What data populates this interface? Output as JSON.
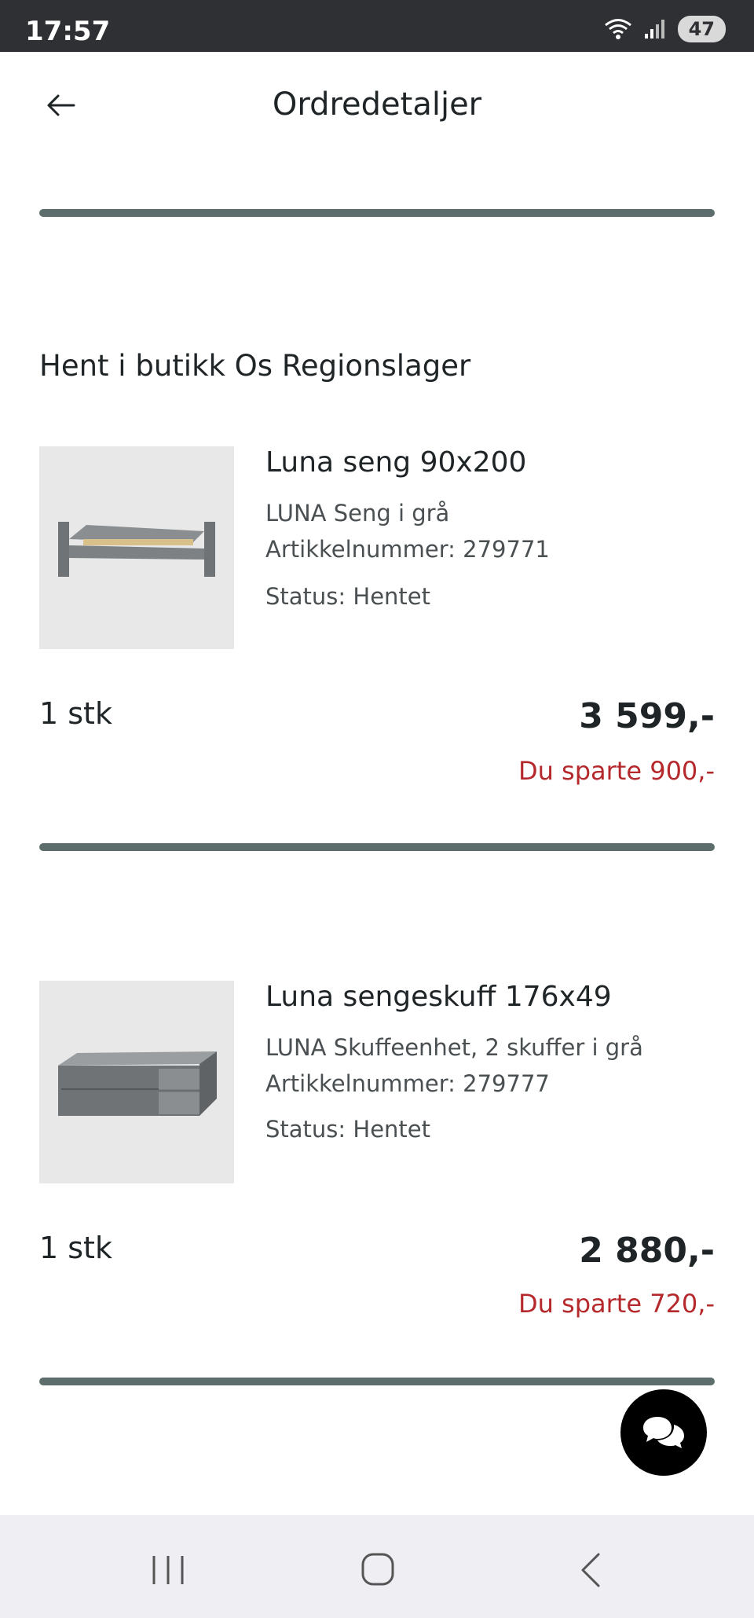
{
  "status_bar": {
    "time": "17:57",
    "battery": "47"
  },
  "header": {
    "title": "Ordredetaljer"
  },
  "section": {
    "title": "Hent i butikk Os Regionslager"
  },
  "items": [
    {
      "name": "Luna seng 90x200",
      "description": "LUNA Seng i grå",
      "article": "Artikkelnummer: 279771",
      "status": "Status: Hentet",
      "quantity": "1 stk",
      "price": "3 599,-",
      "saving": "Du sparte 900,-"
    },
    {
      "name": "Luna sengeskuff 176x49",
      "description": "LUNA Skuffeenhet, 2 skuffer i grå",
      "article": "Artikkelnummer: 279777",
      "status": "Status: Hentet",
      "quantity": "1 stk",
      "price": "2 880,-",
      "saving": "Du sparte 720,-"
    }
  ],
  "icons": {
    "back": "arrow-left-icon",
    "chat": "chat-bubbles-icon",
    "recent": "recent-apps-icon",
    "home": "home-icon",
    "nav_back": "chevron-left-icon"
  },
  "colors": {
    "accent_divider": "#5c6d6b",
    "saving_red": "#b5282b",
    "fab": "#000000"
  }
}
